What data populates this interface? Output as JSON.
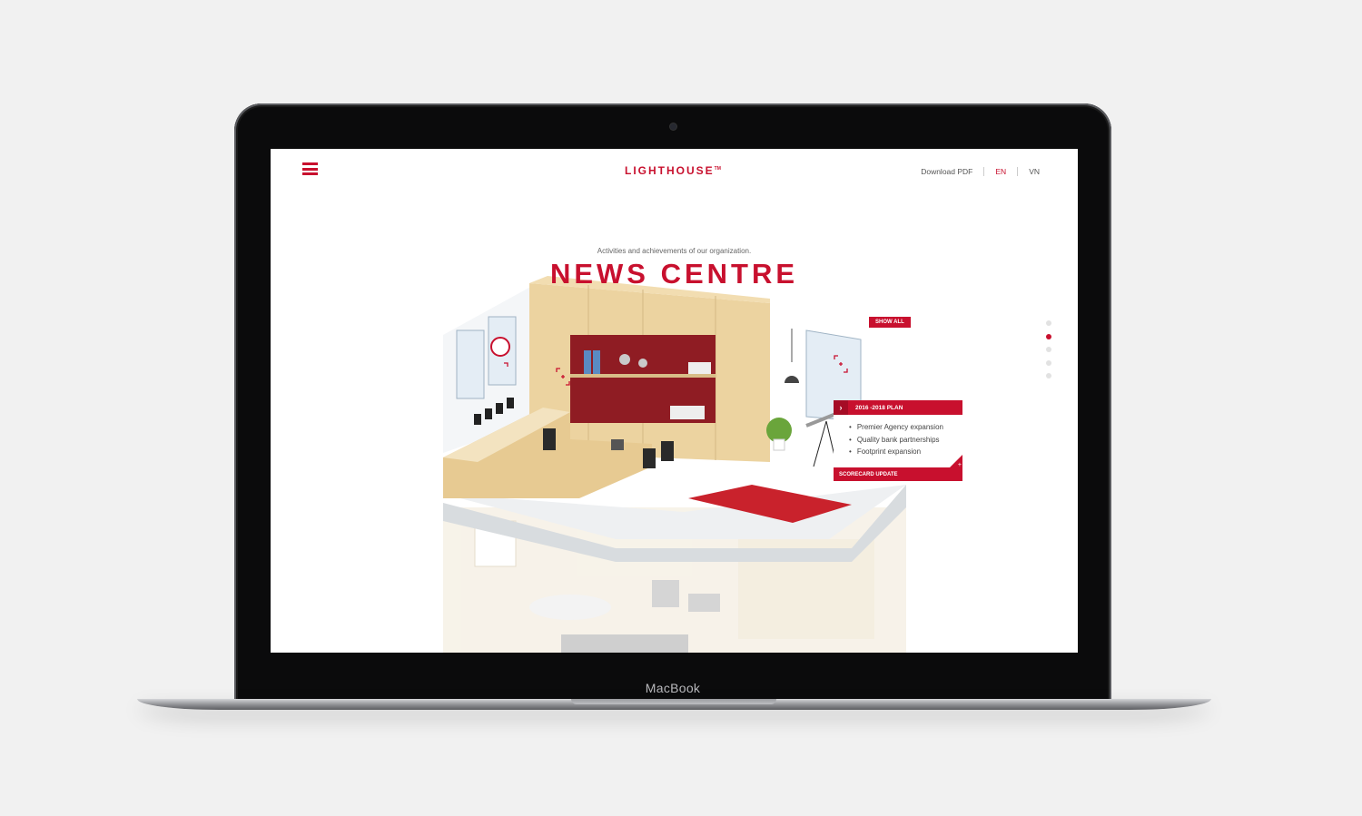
{
  "device": {
    "label": "MacBook"
  },
  "header": {
    "logo": "LIGHTHOUSE",
    "logo_mark": "TM",
    "download": "Download PDF",
    "lang_en": "EN",
    "lang_vn": "VN"
  },
  "hero": {
    "subtitle": "Activities and achievements of our organization.",
    "title": "NEWS CENTRE"
  },
  "show_all": "SHOW ALL",
  "card": {
    "title": "2016 -2018 PLAN",
    "items": [
      "Premier Agency expansion",
      "Quality bank partnerships",
      "Footprint expansion"
    ],
    "footer": "SCORECARD UPDATE"
  },
  "pager": {
    "count": 5,
    "active": 2
  },
  "colors": {
    "accent": "#c8102e",
    "background": "#f1f1f1",
    "bezel": "#0b0b0c"
  },
  "icons": [
    "menu-icon",
    "chevron-right-icon",
    "plus-icon",
    "hotspot-icon"
  ]
}
